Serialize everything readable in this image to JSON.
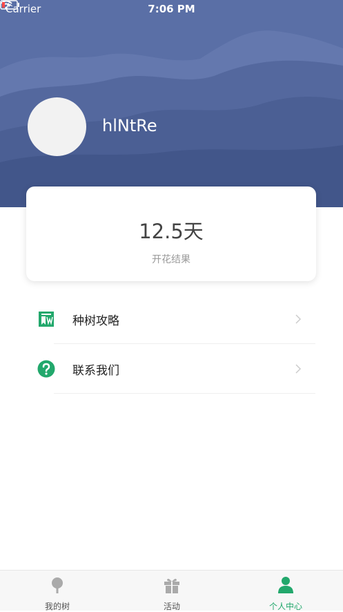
{
  "status_bar": {
    "carrier": "Carrier",
    "time": "7:06 PM"
  },
  "profile": {
    "username": "hlNtRe"
  },
  "stats": {
    "value": "12.5天",
    "label": "开花结果"
  },
  "menu": [
    {
      "label": "种树攻略",
      "icon": "book-icon"
    },
    {
      "label": "联系我们",
      "icon": "help-icon"
    }
  ],
  "tabs": [
    {
      "label": "我的树",
      "icon": "tree-icon"
    },
    {
      "label": "活动",
      "icon": "gift-icon"
    },
    {
      "label": "个人中心",
      "icon": "person-icon",
      "active": true
    }
  ],
  "colors": {
    "accent": "#22a86c",
    "header": "#5a6fa6"
  }
}
